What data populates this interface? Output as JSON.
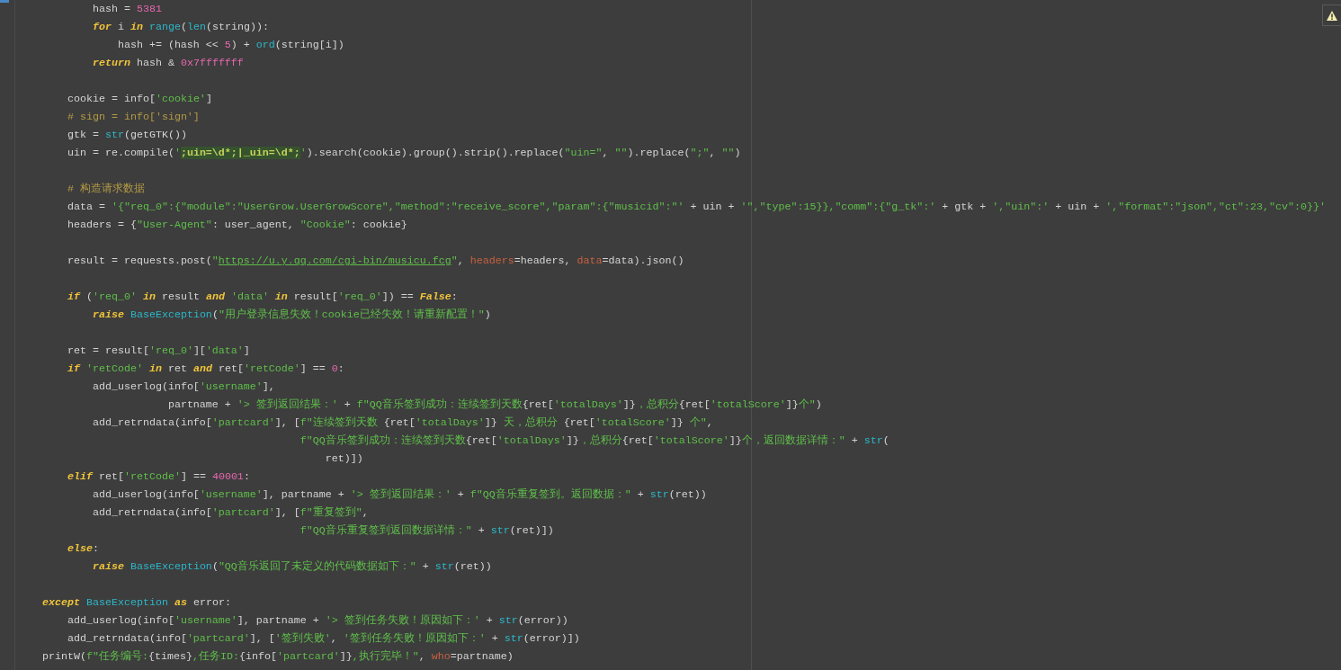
{
  "editor": {
    "lines": [
      {
        "kind": "code",
        "tokens": [
          {
            "kind": "plain",
            "text": "            hash = "
          },
          {
            "kind": "number",
            "text": "5381"
          }
        ]
      },
      {
        "kind": "code",
        "tokens": [
          {
            "kind": "keyword",
            "text": "            for"
          },
          {
            "kind": "plain",
            "text": " i "
          },
          {
            "kind": "keyword",
            "text": "in"
          },
          {
            "kind": "builtin",
            "text": " range"
          },
          {
            "kind": "plain",
            "text": "("
          },
          {
            "kind": "builtin",
            "text": "len"
          },
          {
            "kind": "plain",
            "text": "(string)):"
          }
        ]
      },
      {
        "kind": "code",
        "tokens": [
          {
            "kind": "plain",
            "text": "                hash += (hash << "
          },
          {
            "kind": "number",
            "text": "5"
          },
          {
            "kind": "plain",
            "text": ") + "
          },
          {
            "kind": "builtin",
            "text": "ord"
          },
          {
            "kind": "plain",
            "text": "(string[i])"
          }
        ]
      },
      {
        "kind": "code",
        "tokens": [
          {
            "kind": "keyword",
            "text": "            return"
          },
          {
            "kind": "plain",
            "text": " hash & "
          },
          {
            "kind": "number",
            "text": "0x7fffffff"
          }
        ]
      },
      {
        "kind": "blank"
      },
      {
        "kind": "code",
        "tokens": [
          {
            "kind": "plain",
            "text": "        cookie = info["
          },
          {
            "kind": "string",
            "text": "'cookie'"
          },
          {
            "kind": "plain",
            "text": "]"
          }
        ]
      },
      {
        "kind": "code",
        "tokens": [
          {
            "kind": "comment",
            "text": "        # sign = info['sign']"
          }
        ]
      },
      {
        "kind": "code",
        "tokens": [
          {
            "kind": "plain",
            "text": "        gtk = "
          },
          {
            "kind": "builtin",
            "text": "str"
          },
          {
            "kind": "plain",
            "text": "(getGTK())"
          }
        ]
      },
      {
        "kind": "code",
        "tokens": [
          {
            "kind": "plain",
            "text": "        uin = re.compile("
          },
          {
            "kind": "string",
            "text": "'"
          },
          {
            "kind": "regex",
            "text": ";uin=\\d*;|_uin=\\d*;"
          },
          {
            "kind": "string",
            "text": "'"
          },
          {
            "kind": "plain",
            "text": ").search(cookie).group().strip().replace("
          },
          {
            "kind": "string",
            "text": "\"uin=\""
          },
          {
            "kind": "plain",
            "text": ", "
          },
          {
            "kind": "string",
            "text": "\"\""
          },
          {
            "kind": "plain",
            "text": ").replace("
          },
          {
            "kind": "string",
            "text": "\";\""
          },
          {
            "kind": "plain",
            "text": ", "
          },
          {
            "kind": "string",
            "text": "\"\""
          },
          {
            "kind": "plain",
            "text": ")"
          }
        ]
      },
      {
        "kind": "blank"
      },
      {
        "kind": "code",
        "tokens": [
          {
            "kind": "comment",
            "text": "        # 构造请求数据"
          }
        ]
      },
      {
        "kind": "code",
        "tokens": [
          {
            "kind": "plain",
            "text": "        data = "
          },
          {
            "kind": "string",
            "text": "'{\"req_0\":{\"module\":\"UserGrow.UserGrowScore\",\"method\":\"receive_score\",\"param\":{\"musicid\":\"'"
          },
          {
            "kind": "plain",
            "text": " + uin + "
          },
          {
            "kind": "string",
            "text": "'\",\"type\":15}},\"comm\":{\"g_tk\":'"
          },
          {
            "kind": "plain",
            "text": " + gtk + "
          },
          {
            "kind": "string",
            "text": "',\"uin\":'"
          },
          {
            "kind": "plain",
            "text": " + uin + "
          },
          {
            "kind": "string",
            "text": "',\"format\":\"json\",\"ct\":23,\"cv\":0}}'"
          }
        ]
      },
      {
        "kind": "code",
        "tokens": [
          {
            "kind": "plain",
            "text": "        headers = {"
          },
          {
            "kind": "string",
            "text": "\"User-Agent\""
          },
          {
            "kind": "plain",
            "text": ": user_agent, "
          },
          {
            "kind": "string",
            "text": "\"Cookie\""
          },
          {
            "kind": "plain",
            "text": ": cookie}"
          }
        ]
      },
      {
        "kind": "blank"
      },
      {
        "kind": "code",
        "tokens": [
          {
            "kind": "plain",
            "text": "        result = requests.post("
          },
          {
            "kind": "string",
            "text": "\""
          },
          {
            "kind": "link",
            "text": "https://u.y.qq.com/cgi-bin/musicu.fcg"
          },
          {
            "kind": "string",
            "text": "\""
          },
          {
            "kind": "plain",
            "text": ", "
          },
          {
            "kind": "param",
            "text": "headers"
          },
          {
            "kind": "plain",
            "text": "=headers, "
          },
          {
            "kind": "param",
            "text": "data"
          },
          {
            "kind": "plain",
            "text": "=data).json()"
          }
        ]
      },
      {
        "kind": "blank"
      },
      {
        "kind": "code",
        "tokens": [
          {
            "kind": "keyword",
            "text": "        if"
          },
          {
            "kind": "plain",
            "text": " ("
          },
          {
            "kind": "string",
            "text": "'req_0'"
          },
          {
            "kind": "keyword",
            "text": " in"
          },
          {
            "kind": "plain",
            "text": " result "
          },
          {
            "kind": "keyword",
            "text": "and"
          },
          {
            "kind": "string",
            "text": " 'data'"
          },
          {
            "kind": "keyword",
            "text": " in"
          },
          {
            "kind": "plain",
            "text": " result["
          },
          {
            "kind": "string",
            "text": "'req_0'"
          },
          {
            "kind": "plain",
            "text": "]) == "
          },
          {
            "kind": "keyword",
            "text": "False"
          },
          {
            "kind": "plain",
            "text": ":"
          }
        ]
      },
      {
        "kind": "code",
        "tokens": [
          {
            "kind": "keyword",
            "text": "            raise"
          },
          {
            "kind": "builtin",
            "text": " BaseException"
          },
          {
            "kind": "plain",
            "text": "("
          },
          {
            "kind": "string",
            "text": "\"用户登录信息失效！cookie已经失效！请重新配置！\""
          },
          {
            "kind": "plain",
            "text": ")"
          }
        ]
      },
      {
        "kind": "blank"
      },
      {
        "kind": "code",
        "tokens": [
          {
            "kind": "plain",
            "text": "        ret = result["
          },
          {
            "kind": "string",
            "text": "'req_0'"
          },
          {
            "kind": "plain",
            "text": "]["
          },
          {
            "kind": "string",
            "text": "'data'"
          },
          {
            "kind": "plain",
            "text": "]"
          }
        ]
      },
      {
        "kind": "code",
        "tokens": [
          {
            "kind": "keyword",
            "text": "        if"
          },
          {
            "kind": "string",
            "text": " 'retCode'"
          },
          {
            "kind": "keyword",
            "text": " in"
          },
          {
            "kind": "plain",
            "text": " ret "
          },
          {
            "kind": "keyword",
            "text": "and"
          },
          {
            "kind": "plain",
            "text": " ret["
          },
          {
            "kind": "string",
            "text": "'retCode'"
          },
          {
            "kind": "plain",
            "text": "] == "
          },
          {
            "kind": "number",
            "text": "0"
          },
          {
            "kind": "plain",
            "text": ":"
          }
        ]
      },
      {
        "kind": "code",
        "tokens": [
          {
            "kind": "plain",
            "text": "            add_userlog(info["
          },
          {
            "kind": "string",
            "text": "'username'"
          },
          {
            "kind": "plain",
            "text": "],"
          }
        ]
      },
      {
        "kind": "code",
        "tokens": [
          {
            "kind": "plain",
            "text": "                        partname + "
          },
          {
            "kind": "string",
            "text": "'> 签到返回结果：'"
          },
          {
            "kind": "plain",
            "text": " + "
          },
          {
            "kind": "string",
            "text": "f\"QQ音乐签到成功：连续签到天数"
          },
          {
            "kind": "plain",
            "text": "{ret["
          },
          {
            "kind": "string",
            "text": "'totalDays'"
          },
          {
            "kind": "plain",
            "text": "]}"
          },
          {
            "kind": "string",
            "text": "，总积分"
          },
          {
            "kind": "plain",
            "text": "{ret["
          },
          {
            "kind": "string",
            "text": "'totalScore'"
          },
          {
            "kind": "plain",
            "text": "]}"
          },
          {
            "kind": "string",
            "text": "个\""
          },
          {
            "kind": "plain",
            "text": ")"
          }
        ]
      },
      {
        "kind": "code",
        "tokens": [
          {
            "kind": "plain",
            "text": "            add_retrndata(info["
          },
          {
            "kind": "string",
            "text": "'partcard'"
          },
          {
            "kind": "plain",
            "text": "], ["
          },
          {
            "kind": "string",
            "text": "f\"连续签到天数 "
          },
          {
            "kind": "plain",
            "text": "{ret["
          },
          {
            "kind": "string",
            "text": "'totalDays'"
          },
          {
            "kind": "plain",
            "text": "]}"
          },
          {
            "kind": "string",
            "text": " 天，总积分 "
          },
          {
            "kind": "plain",
            "text": "{ret["
          },
          {
            "kind": "string",
            "text": "'totalScore'"
          },
          {
            "kind": "plain",
            "text": "]}"
          },
          {
            "kind": "string",
            "text": " 个\""
          },
          {
            "kind": "plain",
            "text": ","
          }
        ]
      },
      {
        "kind": "code",
        "tokens": [
          {
            "kind": "string",
            "text": "                                             f\"QQ音乐签到成功：连续签到天数"
          },
          {
            "kind": "plain",
            "text": "{ret["
          },
          {
            "kind": "string",
            "text": "'totalDays'"
          },
          {
            "kind": "plain",
            "text": "]}"
          },
          {
            "kind": "string",
            "text": "，总积分"
          },
          {
            "kind": "plain",
            "text": "{ret["
          },
          {
            "kind": "string",
            "text": "'totalScore'"
          },
          {
            "kind": "plain",
            "text": "]}"
          },
          {
            "kind": "string",
            "text": "个，返回数据详情：\""
          },
          {
            "kind": "plain",
            "text": " + "
          },
          {
            "kind": "builtin",
            "text": "str"
          },
          {
            "kind": "plain",
            "text": "("
          }
        ]
      },
      {
        "kind": "code",
        "tokens": [
          {
            "kind": "plain",
            "text": "                                                 ret)])"
          }
        ]
      },
      {
        "kind": "code",
        "tokens": [
          {
            "kind": "keyword",
            "text": "        elif"
          },
          {
            "kind": "plain",
            "text": " ret["
          },
          {
            "kind": "string",
            "text": "'retCode'"
          },
          {
            "kind": "plain",
            "text": "] == "
          },
          {
            "kind": "number",
            "text": "40001"
          },
          {
            "kind": "plain",
            "text": ":"
          }
        ]
      },
      {
        "kind": "code",
        "tokens": [
          {
            "kind": "plain",
            "text": "            add_userlog(info["
          },
          {
            "kind": "string",
            "text": "'username'"
          },
          {
            "kind": "plain",
            "text": "], partname + "
          },
          {
            "kind": "string",
            "text": "'> 签到返回结果：'"
          },
          {
            "kind": "plain",
            "text": " + "
          },
          {
            "kind": "string",
            "text": "f\"QQ音乐重复签到。返回数据：\""
          },
          {
            "kind": "plain",
            "text": " + "
          },
          {
            "kind": "builtin",
            "text": "str"
          },
          {
            "kind": "plain",
            "text": "(ret))"
          }
        ]
      },
      {
        "kind": "code",
        "tokens": [
          {
            "kind": "plain",
            "text": "            add_retrndata(info["
          },
          {
            "kind": "string",
            "text": "'partcard'"
          },
          {
            "kind": "plain",
            "text": "], ["
          },
          {
            "kind": "string",
            "text": "f\"重复签到\""
          },
          {
            "kind": "plain",
            "text": ","
          }
        ]
      },
      {
        "kind": "code",
        "tokens": [
          {
            "kind": "string",
            "text": "                                             f\"QQ音乐重复签到返回数据详情：\""
          },
          {
            "kind": "plain",
            "text": " + "
          },
          {
            "kind": "builtin",
            "text": "str"
          },
          {
            "kind": "plain",
            "text": "(ret)])"
          }
        ]
      },
      {
        "kind": "code",
        "tokens": [
          {
            "kind": "keyword",
            "text": "        else"
          },
          {
            "kind": "plain",
            "text": ":"
          }
        ]
      },
      {
        "kind": "code",
        "tokens": [
          {
            "kind": "keyword",
            "text": "            raise"
          },
          {
            "kind": "builtin",
            "text": " BaseException"
          },
          {
            "kind": "plain",
            "text": "("
          },
          {
            "kind": "string",
            "text": "\"QQ音乐返回了未定义的代码数据如下：\""
          },
          {
            "kind": "plain",
            "text": " + "
          },
          {
            "kind": "builtin",
            "text": "str"
          },
          {
            "kind": "plain",
            "text": "(ret))"
          }
        ]
      },
      {
        "kind": "blank"
      },
      {
        "kind": "code",
        "tokens": [
          {
            "kind": "keyword",
            "text": "    except"
          },
          {
            "kind": "builtin",
            "text": " BaseException"
          },
          {
            "kind": "keyword",
            "text": " as"
          },
          {
            "kind": "plain",
            "text": " error:"
          }
        ]
      },
      {
        "kind": "code",
        "tokens": [
          {
            "kind": "plain",
            "text": "        add_userlog(info["
          },
          {
            "kind": "string",
            "text": "'username'"
          },
          {
            "kind": "plain",
            "text": "], partname + "
          },
          {
            "kind": "string",
            "text": "'> 签到任务失败！原因如下：'"
          },
          {
            "kind": "plain",
            "text": " + "
          },
          {
            "kind": "builtin",
            "text": "str"
          },
          {
            "kind": "plain",
            "text": "(error))"
          }
        ]
      },
      {
        "kind": "code",
        "tokens": [
          {
            "kind": "plain",
            "text": "        add_retrndata(info["
          },
          {
            "kind": "string",
            "text": "'partcard'"
          },
          {
            "kind": "plain",
            "text": "], ["
          },
          {
            "kind": "string",
            "text": "'签到失败'"
          },
          {
            "kind": "plain",
            "text": ", "
          },
          {
            "kind": "string",
            "text": "'签到任务失败！原因如下：'"
          },
          {
            "kind": "plain",
            "text": " + "
          },
          {
            "kind": "builtin",
            "text": "str"
          },
          {
            "kind": "plain",
            "text": "(error)])"
          }
        ]
      },
      {
        "kind": "code",
        "tokens": [
          {
            "kind": "plain",
            "text": "    printW("
          },
          {
            "kind": "string",
            "text": "f\"任务编号:"
          },
          {
            "kind": "plain",
            "text": "{times}"
          },
          {
            "kind": "string",
            "text": ",任务ID:"
          },
          {
            "kind": "plain",
            "text": "{info["
          },
          {
            "kind": "string",
            "text": "'partcard'"
          },
          {
            "kind": "plain",
            "text": "]}"
          },
          {
            "kind": "string",
            "text": ",执行完毕！\""
          },
          {
            "kind": "plain",
            "text": ", "
          },
          {
            "kind": "param",
            "text": "who"
          },
          {
            "kind": "plain",
            "text": "=partname)"
          }
        ]
      }
    ]
  }
}
